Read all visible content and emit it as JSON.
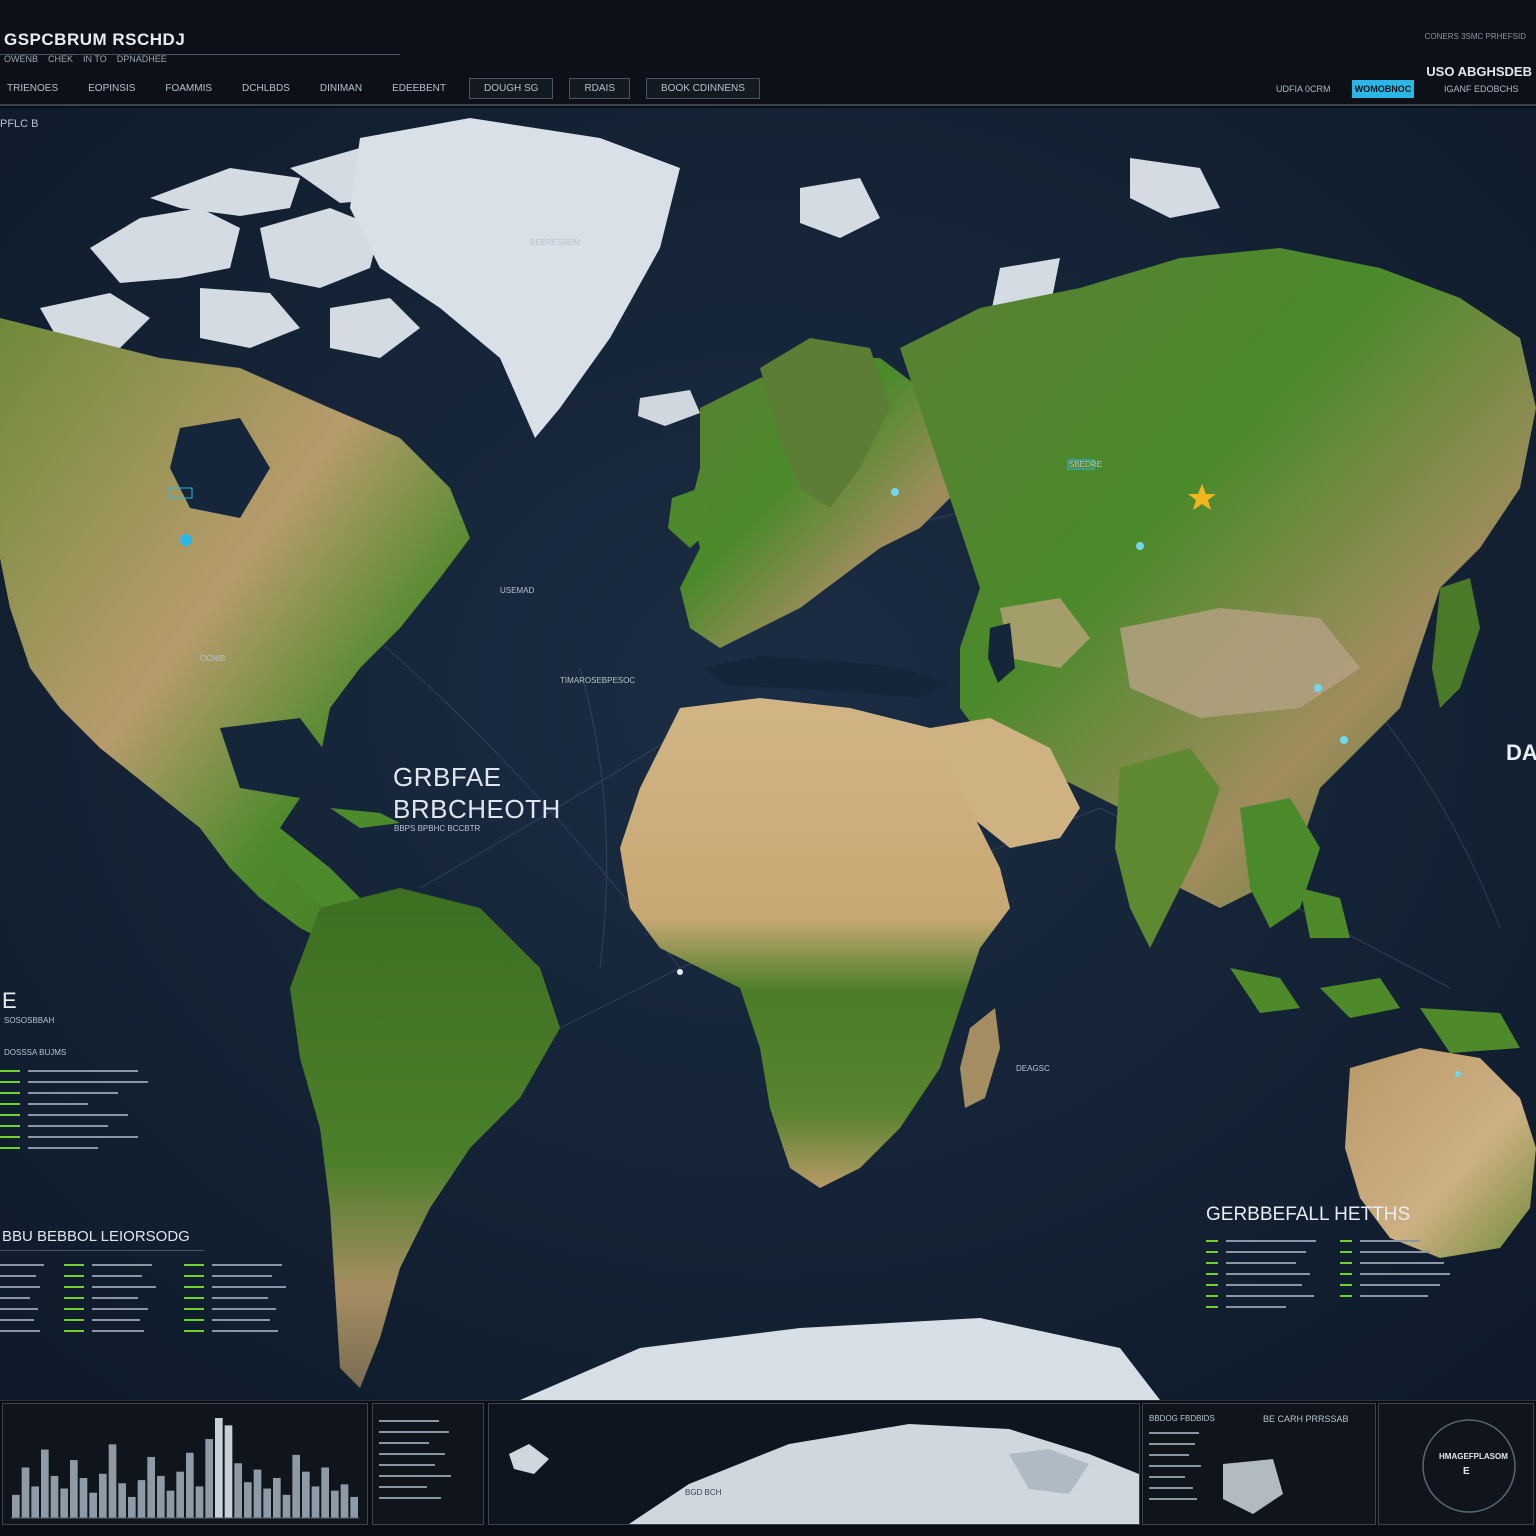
{
  "header": {
    "title": "GSPCBRUM RSCHDJ",
    "subtitle_items": [
      "OWENB",
      "CHEK",
      "IN TO",
      "DPNADHEE"
    ],
    "tabs": [
      "TRIENOES",
      "EOPINSIS",
      "FOAMMIS",
      "DCHLBDS",
      "DINIMAN",
      "EDEEBENT"
    ],
    "boxed_tabs": [
      "DOUGH SG",
      "RDAIS",
      "BOOK CDINNENS"
    ],
    "meta_top_right": "CONERS 3SMC PRHEFSID",
    "label_top_right": "USO ABGHSDEB",
    "accent_button": "WOMOBNOC",
    "chip_left": "UDFIA 0CRM",
    "chip_right": "IGANF EDOBCHS",
    "corner_label": "PFLC B"
  },
  "map": {
    "labels": {
      "greenland": "BEERESREM",
      "main_title_1": "GRBFAE",
      "main_title_2": "BRBCHEOTH",
      "main_sub": "BBPS BPBHC BCCBTR",
      "left_big": "E",
      "left_sub": "SOSOSBBAH",
      "left_header": "DOSSSA BUJMS",
      "right_big": "DA",
      "right_title": "GERBBEFALL HETTHS",
      "bottom_left_title": "BBU BEBBOL LEIORSODG",
      "ocean_label_1": "TIMAROSEBPESOC",
      "ocean_label_2": "USEMAD",
      "ocean_label_3": "DEAGSC",
      "na_label": "OCNIB",
      "russia_label": "SBEDRE"
    }
  },
  "bottom": {
    "map_panel_label": "BGD BCH",
    "info_title": "BBDOG FBDBIDS",
    "info_title_2": "BE CARH PRRSSAB",
    "circle_label": "HMAGEFPLASOM",
    "circle_sub": "E"
  },
  "colors": {
    "ocean": "#14253a",
    "land_green": "#4f7a2c",
    "land_desert": "#c9a97a",
    "ice": "#dde3ea",
    "accent": "#2bb7e6",
    "legend_green": "#6fd22c"
  },
  "chart_data": {
    "type": "bar",
    "title": "",
    "values": [
      22,
      48,
      30,
      65,
      40,
      28,
      55,
      38,
      24,
      42,
      70,
      33,
      20,
      36,
      58,
      40,
      26,
      44,
      62,
      30,
      75,
      95,
      88,
      52,
      34,
      46,
      28,
      38,
      22,
      60,
      44,
      30,
      48,
      26,
      32,
      20
    ]
  }
}
